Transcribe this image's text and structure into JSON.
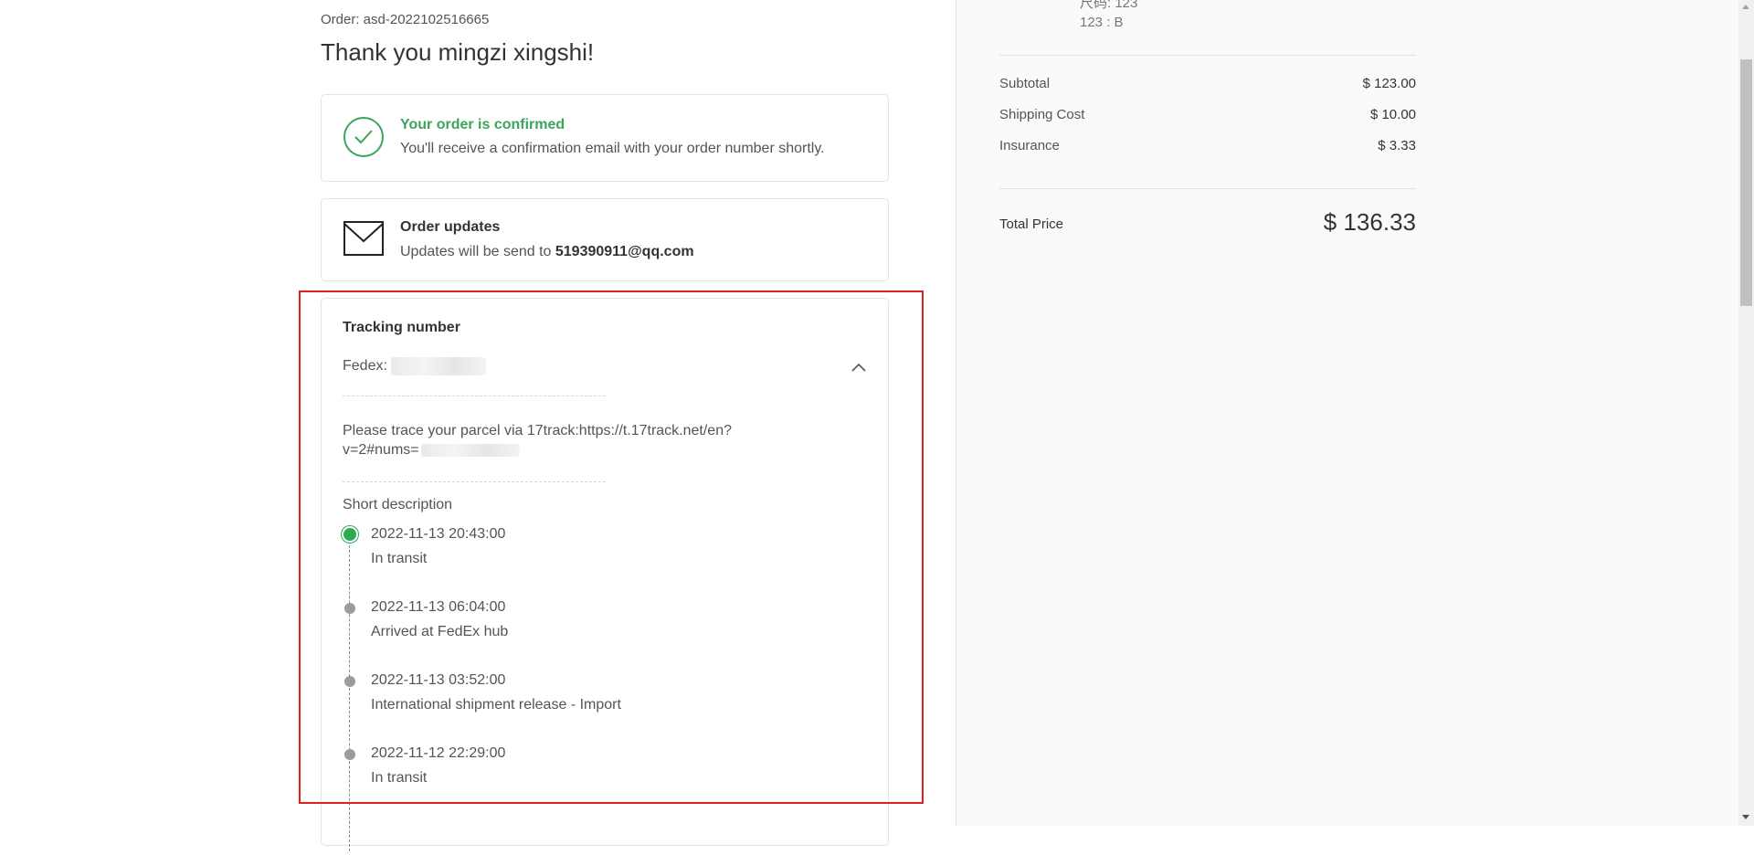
{
  "order": {
    "number_text": "Order: asd-2022102516665",
    "thank_you": "Thank you mingzi xingshi!"
  },
  "confirmation": {
    "title": "Your order is confirmed",
    "subtitle": "You'll receive a confirmation email with your order number shortly.",
    "icon": "check-circle-icon",
    "color": "#3aa55a"
  },
  "updates": {
    "title": "Order updates",
    "subtitle_prefix": "Updates will be send to ",
    "email": "519390911@qq.com",
    "icon": "envelope-icon"
  },
  "tracking": {
    "title": "Tracking number",
    "carrier_label": "Fedex:",
    "trace_line1": "Please trace your parcel via 17track:https://t.17track.net/en?",
    "trace_line2": "v=2#nums=",
    "short_description_label": "Short description",
    "events": [
      {
        "time": "2022-11-13 20:43:00",
        "status": "In transit",
        "active": true
      },
      {
        "time": "2022-11-13 06:04:00",
        "status": "Arrived at FedEx hub",
        "active": false
      },
      {
        "time": "2022-11-13 03:52:00",
        "status": "International shipment release - Import",
        "active": false
      },
      {
        "time": "2022-11-12 22:29:00",
        "status": "In transit",
        "active": false
      }
    ],
    "active_color": "#2eaa50",
    "highlight_color": "#e02020"
  },
  "summary": {
    "item_variant_1": "尺码: 123",
    "item_variant_2": "123 : B",
    "subtotal_label": "Subtotal",
    "subtotal_value": "$ 123.00",
    "shipping_label": "Shipping Cost",
    "shipping_value": "$ 10.00",
    "insurance_label": "Insurance",
    "insurance_value": "$ 3.33",
    "total_label": "Total Price",
    "total_value": "$ 136.33"
  }
}
